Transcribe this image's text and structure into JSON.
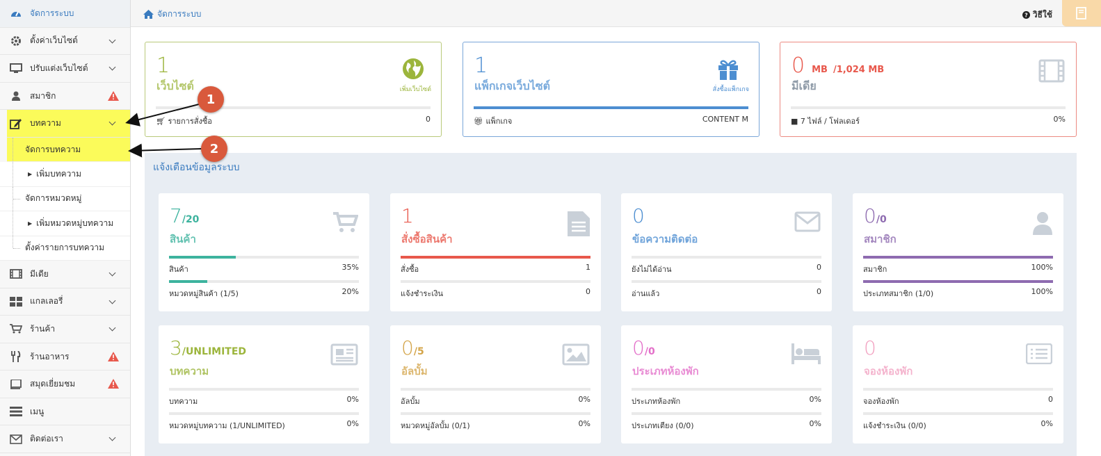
{
  "colors": {
    "green": "#9cb53c",
    "blue": "#4d8ed1",
    "red": "#e8584c",
    "teal": "#3db39e",
    "purple": "#8e6bb0",
    "gold": "#d4a54a",
    "pink": "#e36fc9",
    "lightpink": "#f2a1c1",
    "gray": "#c9d0d8"
  },
  "sidebar": {
    "dashboard": "จัดการระบบ",
    "items": [
      {
        "label": "ตั้งค่าเว็บไซต์",
        "icon": "gear-icon"
      },
      {
        "label": "ปรับแต่งเว็บไซต์",
        "icon": "monitor-icon"
      },
      {
        "label": "สมาชิก",
        "icon": "user-icon"
      },
      {
        "label": "บทความ",
        "icon": "edit-icon"
      }
    ],
    "sub": [
      "จัดการบทความ",
      "เพิ่มบทความ",
      "จัดการหมวดหมู่",
      "เพิ่มหมวดหมู่บทความ",
      "ตั้งค่ารายการบทความ"
    ],
    "items2": [
      {
        "label": "มีเดีย",
        "icon": "film-icon"
      },
      {
        "label": "แกลเลอรี่",
        "icon": "grid-icon"
      },
      {
        "label": "ร้านค้า",
        "icon": "cart-icon"
      },
      {
        "label": "ร้านอาหาร",
        "icon": "utensils-icon"
      },
      {
        "label": "สมุดเยี่ยมชม",
        "icon": "book-icon"
      },
      {
        "label": "เมนู",
        "icon": "menu-icon"
      },
      {
        "label": "ติดต่อเรา",
        "icon": "envelope-icon"
      }
    ]
  },
  "topbar": {
    "breadcrumb": "จัดการระบบ",
    "help": "วิธีใช้"
  },
  "cards": [
    {
      "num": "1",
      "label": "เว็บไซต์",
      "action": "เพิ่มเว็บไซต์",
      "foot_label": "รายการสั่งซื้อ",
      "foot_value": "0",
      "progress": 0
    },
    {
      "num": "1",
      "label": "แพ็กเกจเว็บไซต์",
      "action": "สั่งซื้อแพ็กเกจ",
      "foot_label": "แพ็กเกจ",
      "foot_value": "CONTENT M",
      "progress": 100
    },
    {
      "num": "0",
      "unit": "MB",
      "quota": "/1,024 MB",
      "label": "มีเดีย",
      "foot_label": "7 ไฟล์ / โฟลเดอร์",
      "foot_value": "0%",
      "progress": 0
    }
  ],
  "panel": {
    "title": "แจ้งเตือนข้อมูลระบบ",
    "stats": [
      {
        "num": "7",
        "den": "/20",
        "label": "สินค้า",
        "r1": [
          "สินค้า",
          "35%"
        ],
        "p1": 35,
        "r2": [
          "หมวดหมู่สินค้า (1/5)",
          "20%"
        ],
        "p2": 20
      },
      {
        "num": "1",
        "den": "",
        "label": "สั่งซื้อสินค้า",
        "r1": [
          "สั่งซื้อ",
          "1"
        ],
        "p1": 100,
        "r2": [
          "แจ้งชำระเงิน",
          "0"
        ],
        "p2": 0
      },
      {
        "num": "0",
        "den": "",
        "label": "ข้อความติดต่อ",
        "r1": [
          "ยังไม่ได้อ่าน",
          "0"
        ],
        "p1": 0,
        "r2": [
          "อ่านแล้ว",
          "0"
        ],
        "p2": 0
      },
      {
        "num": "0",
        "den": "/0",
        "label": "สมาชิก",
        "r1": [
          "สมาชิก",
          "100%"
        ],
        "p1": 100,
        "r2": [
          "ประเภทสมาชิก (1/0)",
          "100%"
        ],
        "p2": 100
      },
      {
        "num": "3",
        "den": "/UNLIMITED",
        "label": "บทความ",
        "r1": [
          "บทความ",
          "0%"
        ],
        "p1": 0,
        "r2": [
          "หมวดหมู่บทความ (1/UNLIMITED)",
          "0%"
        ],
        "p2": 0
      },
      {
        "num": "0",
        "den": "/5",
        "label": "อัลบั้ม",
        "r1": [
          "อัลบั้ม",
          "0%"
        ],
        "p1": 0,
        "r2": [
          "หมวดหมู่อัลบั้ม (0/1)",
          "0%"
        ],
        "p2": 0
      },
      {
        "num": "0",
        "den": "/0",
        "label": "ประเภทห้องพัก",
        "r1": [
          "ประเภทห้องพัก",
          "0%"
        ],
        "p1": 0,
        "r2": [
          "ประเภทเตียง (0/0)",
          "0%"
        ],
        "p2": 0
      },
      {
        "num": "0",
        "den": "",
        "label": "จองห้องพัก",
        "r1": [
          "จองห้องพัก",
          "0"
        ],
        "p1": 0,
        "r2": [
          "แจ้งชำระเงิน (0/0)",
          "0%"
        ],
        "p2": 0
      }
    ]
  },
  "annotations": {
    "one": "1",
    "two": "2"
  }
}
